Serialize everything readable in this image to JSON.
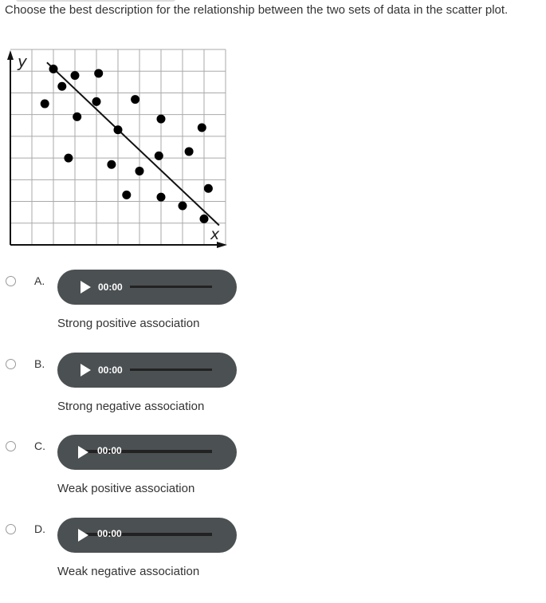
{
  "question": "Choose the best description for the relationship between the two sets of data in the scatter plot.",
  "scatter_plot": {
    "type": "scatter",
    "xlabel": "x",
    "ylabel": "y",
    "xlim": [
      0,
      10
    ],
    "ylim": [
      0,
      9
    ],
    "grid": true,
    "points": [
      [
        2.0,
        8.1
      ],
      [
        3.0,
        7.8
      ],
      [
        4.1,
        7.9
      ],
      [
        2.4,
        7.3
      ],
      [
        1.6,
        6.5
      ],
      [
        4.0,
        6.6
      ],
      [
        5.8,
        6.7
      ],
      [
        3.1,
        5.9
      ],
      [
        5.0,
        5.3
      ],
      [
        7.0,
        5.8
      ],
      [
        8.9,
        5.4
      ],
      [
        2.7,
        4.0
      ],
      [
        4.7,
        3.7
      ],
      [
        6.0,
        3.4
      ],
      [
        6.9,
        4.1
      ],
      [
        8.3,
        4.3
      ],
      [
        5.4,
        2.3
      ],
      [
        7.0,
        2.2
      ],
      [
        8.0,
        1.8
      ],
      [
        9.2,
        2.6
      ],
      [
        9.0,
        1.2
      ]
    ],
    "trend_line": [
      [
        1.7,
        8.4
      ],
      [
        9.7,
        0.9
      ]
    ]
  },
  "options": [
    {
      "letter": "A.",
      "time": "00:00",
      "text": "Strong positive association"
    },
    {
      "letter": "B.",
      "time": "00:00",
      "text": "Strong negative association"
    },
    {
      "letter": "C.",
      "time": "00:00",
      "text": "Weak positive association"
    },
    {
      "letter": "D.",
      "time": "00:00",
      "text": "Weak negative association"
    }
  ]
}
